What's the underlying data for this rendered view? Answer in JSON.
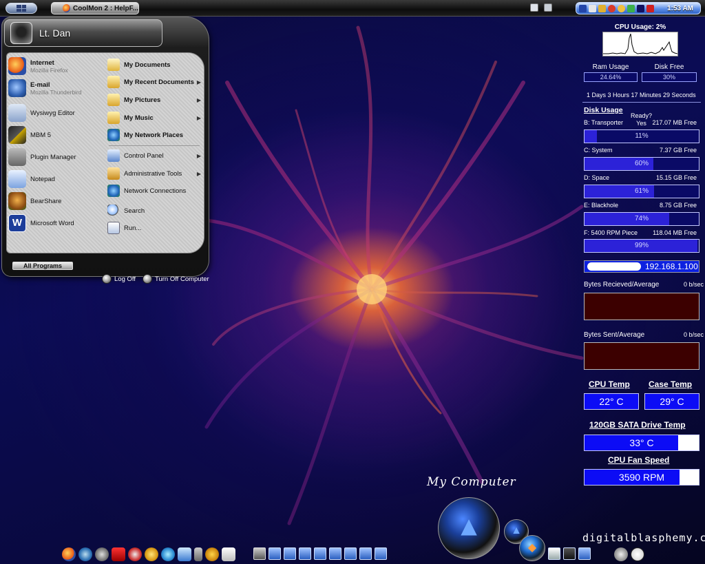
{
  "taskbar": {
    "active_task": "CoolMon 2 : HelpF...",
    "clock": "1:53 AM"
  },
  "start_menu": {
    "user_name": "Lt. Dan",
    "pinned": [
      {
        "label": "Internet",
        "sub": "Mozilla Firefox",
        "icon": "firefox-icon"
      },
      {
        "label": "E-mail",
        "sub": "Mozilla Thunderbird",
        "icon": "thunderbird-icon"
      }
    ],
    "recent": [
      {
        "label": "Wysiwyg Editor",
        "icon": "editor-icon"
      },
      {
        "label": "MBM 5",
        "icon": "chip-icon"
      },
      {
        "label": "Plugin Manager",
        "icon": "plugin-icon"
      },
      {
        "label": "Notepad",
        "icon": "notepad-icon"
      },
      {
        "label": "BearShare",
        "icon": "bearshare-icon"
      },
      {
        "label": "Microsoft Word",
        "icon": "word-icon"
      }
    ],
    "places": [
      {
        "label": "My Documents",
        "icon": "documents-folder-icon",
        "arrow": false
      },
      {
        "label": "My Recent Documents",
        "icon": "recent-folder-icon",
        "arrow": true
      },
      {
        "label": "My Pictures",
        "icon": "pictures-folder-icon",
        "arrow": true
      },
      {
        "label": "My Music",
        "icon": "music-folder-icon",
        "arrow": true
      },
      {
        "label": "My Network Places",
        "icon": "network-places-icon",
        "arrow": false
      }
    ],
    "system": [
      {
        "label": "Control Panel",
        "icon": "control-panel-icon",
        "arrow": true
      },
      {
        "label": "Administrative Tools",
        "icon": "admin-tools-icon",
        "arrow": true
      },
      {
        "label": "Network Connections",
        "icon": "network-connections-icon",
        "arrow": false
      },
      {
        "label": "Search",
        "icon": "search-icon",
        "arrow": false
      },
      {
        "label": "Run...",
        "icon": "run-icon",
        "arrow": false
      }
    ],
    "all_programs": "All Programs",
    "log_off": "Log Off",
    "turn_off": "Turn Off Computer"
  },
  "monitor": {
    "cpu_usage_title": "CPU Usage: 2%",
    "ram_label": "Ram Usage",
    "ram_value": "24.64%",
    "disk_free_label": "Disk Free",
    "disk_free_value": "30%",
    "uptime": "1 Days 3 Hours 17 Minutes 29 Seconds",
    "disk_usage_title": "Disk Usage",
    "ready_label": "Ready?",
    "ready_value": "Yes",
    "drives": [
      {
        "name": "B: Transporter",
        "free": "217.07  MB Free",
        "percent": 11
      },
      {
        "name": "C: System",
        "free": "7.37  GB Free",
        "percent": 60
      },
      {
        "name": "D: Space",
        "free": "15.15  GB Free",
        "percent": 61
      },
      {
        "name": "E: Blackhole",
        "free": "8.75  GB Free",
        "percent": 74
      },
      {
        "name": "F: 5400 RPM Piece",
        "free": "118.04  MB Free",
        "percent": 99
      }
    ],
    "ip_address": "192.168.1.100",
    "bytes_received_label": "Bytes Recieved/Average",
    "bytes_received_value": "0  b/sec",
    "bytes_sent_label": "Bytes Sent/Average",
    "bytes_sent_value": "0  b/sec",
    "cpu_temp_label": "CPU Temp",
    "cpu_temp_value": "22° C",
    "case_temp_label": "Case Temp",
    "case_temp_value": "29° C",
    "drive_temp_label": "120GB SATA Drive Temp",
    "drive_temp_value": "33° C",
    "drive_temp_fill": 0.82,
    "fan_label": "CPU Fan Speed",
    "fan_value": "3590 RPM",
    "fan_fill": 0.83
  },
  "desktop": {
    "my_computer_label": "My Computer",
    "brand": "digitalblasphemy.com"
  },
  "colors": {
    "bar_fill": "#2c22d8",
    "temp_blue": "#0c0cf5",
    "net_graph_bg": "#3c0000"
  }
}
